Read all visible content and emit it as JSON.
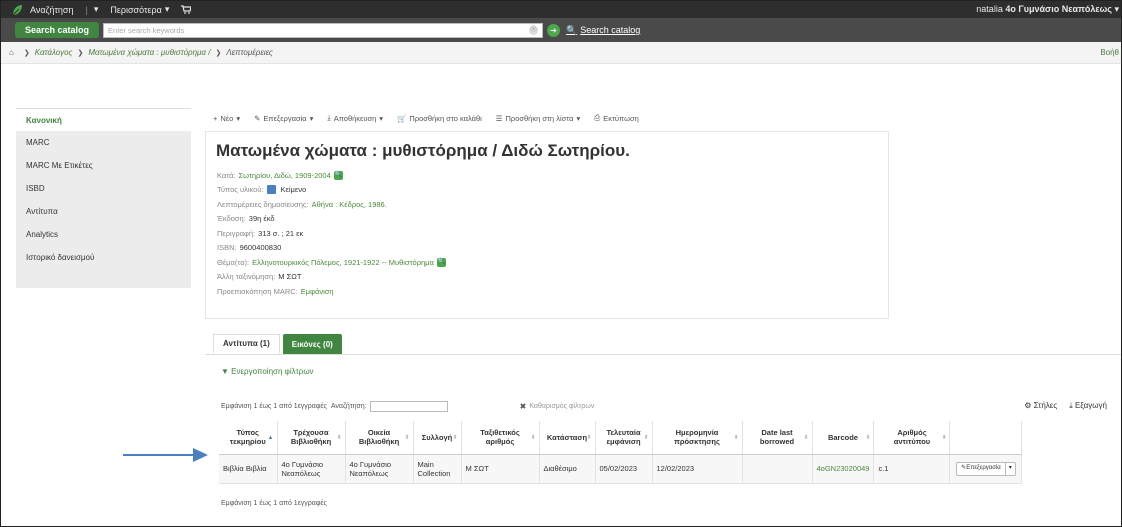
{
  "topnav": {
    "search_label": "Αναζήτηση",
    "more_label": "Περισσότερα",
    "user_name": "natalia",
    "user_branch": "4ο Γυμνάσιο Νεαπόλεως"
  },
  "searchbar": {
    "tab_label": "Search catalog",
    "placeholder": "Enter search keywords",
    "submit_label": "Search catalog"
  },
  "breadcrumb": {
    "items": [
      "Κατάλογος",
      "Ματωμένα χώματα : μυθιστόρημα /",
      "Λεπτομέρειες"
    ],
    "help": "Βοήθ"
  },
  "sidebar": {
    "items": [
      "Κανονική",
      "MARC",
      "MARC Με Ετικέτες",
      "ISBD",
      "Αντίτυπα",
      "Analytics",
      "Ιστορικό δανεισμού"
    ]
  },
  "toolbar": {
    "new": "Νέο",
    "edit": "Επεξεργασία",
    "save": "Αποθήκευση",
    "cart": "Προσθήκη στο καλάθι",
    "list": "Προσθήκη στη λίστα",
    "print": "Εκτύπωση"
  },
  "record": {
    "title": "Ματωμένα χώματα : μυθιστόρημα / Διδώ Σωτηρίου.",
    "by_label": "Κατά:",
    "by_value": "Σωτηρίου, Διδώ, 1909-2004",
    "type_label": "Τύπος υλικού:",
    "type_value": "Κείμενο",
    "pub_label": "Λεπτομέρειες δημοσίευσης:",
    "pub_value": "Αθήνα : Κέδρος, 1986.",
    "edition_label": "Έκδοση:",
    "edition_value": "39η έκδ",
    "desc_label": "Περιγραφή:",
    "desc_value": "313 σ. ; 21 εκ",
    "isbn_label": "ISBN:",
    "isbn_value": "9600400830",
    "subject_label": "Θέμα(τα):",
    "subject_value": "Ελληνοτουρκικός Πόλεμος, 1921-1922 -- Μυθιστόρημα",
    "class_label": "Άλλη ταξινόμηση:",
    "class_value": "Μ ΣΩΤ",
    "marc_label": "Προεπισκόπηση MARC:",
    "marc_value": "Εμφάνιση"
  },
  "tabs": {
    "copies": "Αντίτυπα (1)",
    "images": "Εικόνες (0)"
  },
  "holdings": {
    "filter_toggle": "Ενεργοποίηση φίλτρων",
    "showing": "Εμφάνιση 1 έως 1 από 1εγγραφές",
    "search_label": "Αναζήτηση:",
    "clear_filters": "Καθαρισμός φίλτρων",
    "columns_label": "Στήλες",
    "export_label": "Εξαγωγή",
    "headers": [
      "Τύπος τεκμηρίου",
      "Τρέχουσα Βιβλιοθήκη",
      "Οικεία Βιβλιοθήκη",
      "Συλλογή",
      "Ταξιθετικός αριθμός",
      "Κατάσταση",
      "Τελευταία εμφάνιση",
      "Ημερομηνία πρόσκτησης",
      "Date last borrowed",
      "Barcode",
      "Αριθμός αντιτύπου"
    ],
    "row": {
      "item_type": "Βιβλία Βιβλία",
      "current_library": "4ο Γυμνάσιο Νεαπόλεως",
      "home_library": "4ο Γυμνάσιο Νεαπόλεως",
      "collection": "Main Collection",
      "call_number": "Μ ΣΩΤ",
      "status": "Διαθέσιμο",
      "last_seen": "05/02/2023",
      "acquired": "12/02/2023",
      "last_borrowed": "",
      "barcode": "4oGN23020049",
      "copy_number": "c.1",
      "edit_label": "Επεξεργασία"
    },
    "footer": "Εμφάνιση 1 έως 1 από 1εγγραφές"
  },
  "colors": {
    "accent_green": "#408540",
    "link_green": "#4a8a3a",
    "arrow_blue": "#4a7fc1"
  }
}
